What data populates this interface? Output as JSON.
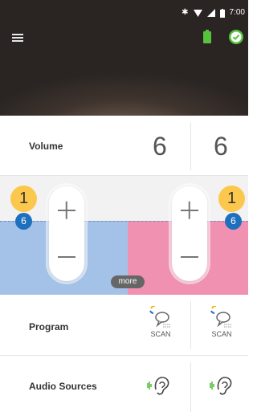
{
  "status_bar": {
    "time": "7:00",
    "icons": [
      "bluetooth-icon",
      "wifi-icon",
      "signal-icon",
      "battery-icon"
    ]
  },
  "header": {
    "menu_icon": "hamburger-menu-icon",
    "device_battery_icon": "battery-icon",
    "connected_icon": "check-circle-icon"
  },
  "volume": {
    "label": "Volume",
    "left": "6",
    "right": "6"
  },
  "control": {
    "left_program": "1",
    "left_level": "6",
    "right_program": "1",
    "right_level": "6",
    "more_label": "more",
    "colors": {
      "left": "#a4c2e8",
      "right": "#f191b1",
      "badge_yellow": "#fbc84d",
      "badge_blue": "#1f6fbf"
    }
  },
  "program": {
    "label": "Program",
    "left_mode": "SCAN",
    "right_mode": "SCAN"
  },
  "audio_sources": {
    "label": "Audio Sources",
    "icon": "hearing-ear-icon"
  }
}
